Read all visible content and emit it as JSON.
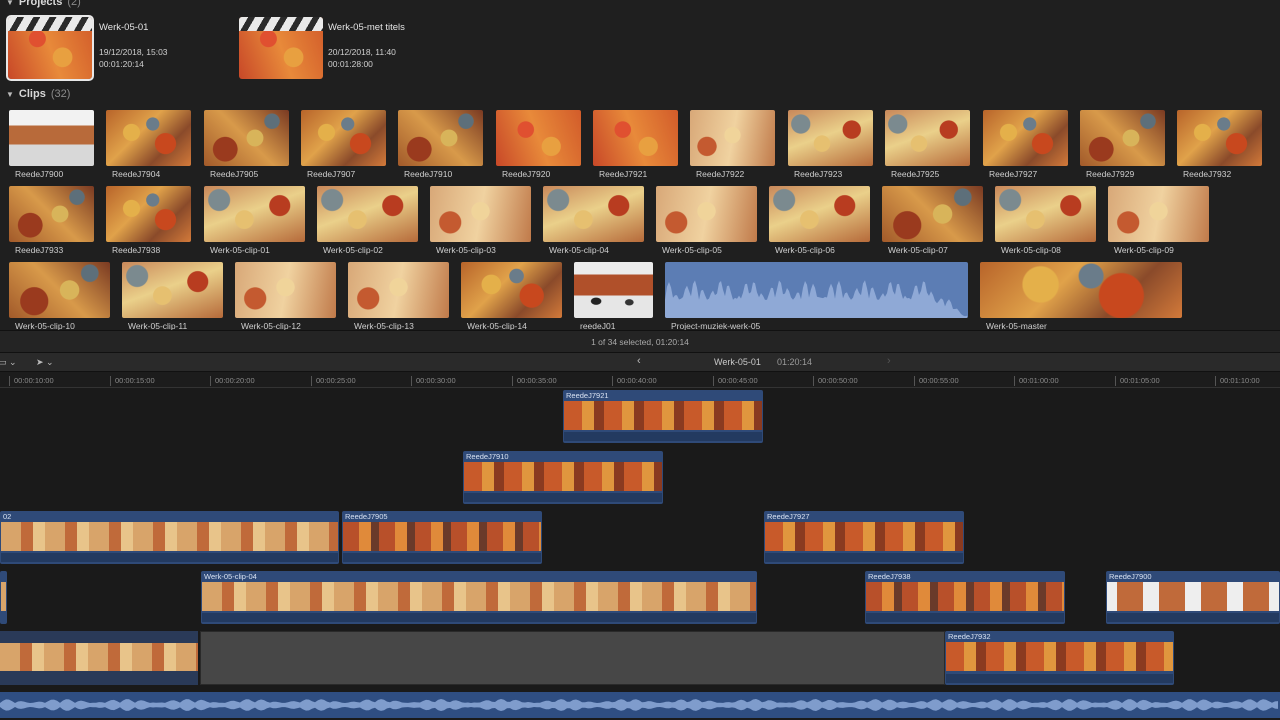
{
  "browser": {
    "projects_label": "Projects",
    "projects_count": "(2)",
    "projects": [
      {
        "title": "Werk-05-01",
        "date": "19/12/2018, 15:03",
        "duration": "00:01:20:14"
      },
      {
        "title": "Werk-05-met titels",
        "date": "20/12/2018, 11:40",
        "duration": "00:01:28:00"
      }
    ],
    "clips_label": "Clips",
    "clips_count": "(32)",
    "clips": [
      "ReedeJ7900",
      "ReedeJ7904",
      "ReedeJ7905",
      "ReedeJ7907",
      "ReedeJ7910",
      "ReedeJ7920",
      "ReedeJ7921",
      "ReedeJ7922",
      "ReedeJ7923",
      "ReedeJ7925",
      "ReedeJ7927",
      "ReedeJ7929",
      "ReedeJ7932",
      "ReedeJ7933",
      "ReedeJ7938",
      "Werk-05-clip-01",
      "Werk-05-clip-02",
      "Werk-05-clip-03",
      "Werk-05-clip-04",
      "Werk-05-clip-05",
      "Werk-05-clip-06",
      "Werk-05-clip-07",
      "Werk-05-clip-08",
      "Werk-05-clip-09",
      "Werk-05-clip-10",
      "Werk-05-clip-11",
      "Werk-05-clip-12",
      "Werk-05-clip-13",
      "Werk-05-clip-14",
      "reedeJ01",
      "Project-muziek-werk-05",
      "Werk-05-master"
    ],
    "status": "1 of 34 selected, 01:20:14"
  },
  "timeline_header": {
    "back_icon": "chevron-left-icon",
    "forward_icon": "chevron-right-icon",
    "project_name": "Werk-05-01",
    "duration": "01:20:14"
  },
  "ruler": {
    "ticks": [
      "00:00:10:00",
      "00:00:15:00",
      "00:00:20:00",
      "00:00:25:00",
      "00:00:30:00",
      "00:00:35:00",
      "00:00:40:00",
      "00:00:45:00",
      "00:00:50:00",
      "00:00:55:00",
      "00:01:00:00",
      "00:01:05:00",
      "00:01:10:00"
    ]
  },
  "timeline": {
    "clips": [
      {
        "label": "ReedeJ7921"
      },
      {
        "label": "ReedeJ7910"
      },
      {
        "label": "02"
      },
      {
        "label": "ReedeJ7905"
      },
      {
        "label": "ReedeJ7927"
      },
      {
        "label": "Werk-05-clip-04"
      },
      {
        "label": "ReedeJ7938"
      },
      {
        "label": "ReedeJ7900"
      },
      {
        "label": "ReedeJ7932"
      }
    ]
  },
  "colors": {
    "clip_blue": "#2f4a78",
    "audio_blue": "#5c7db4",
    "selection": "#e8e8e8"
  }
}
